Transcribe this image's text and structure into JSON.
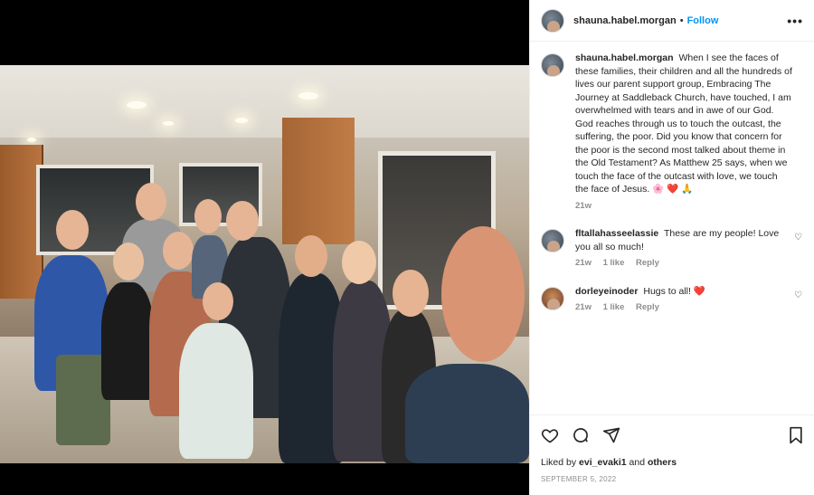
{
  "header": {
    "username": "shauna.habel.morgan",
    "separator": "•",
    "follow_label": "Follow",
    "more_label": "•••"
  },
  "caption": {
    "username": "shauna.habel.morgan",
    "text": "When I see the faces of these families, their children and all the hundreds of lives our parent support group, Embracing The Journey at Saddleback Church, have touched, I am overwhelmed with tears and in awe of our God. God reaches through us to touch the outcast, the suffering, the poor. Did you know that concern for the poor is the second most talked about theme in the Old Testament? As Matthew 25 says, when we touch the face of the outcast with love, we touch the face of Jesus.",
    "emoji": "🌸 ❤️ 🙏",
    "time": "21w"
  },
  "comments": [
    {
      "username": "fltallahasseelassie",
      "text": "These are my people! Love you all so much!",
      "time": "21w",
      "likes": "1 like",
      "reply": "Reply"
    },
    {
      "username": "dorleyeinoder",
      "text": "Hugs to all!",
      "emoji": "❤️",
      "time": "21w",
      "likes": "1 like",
      "reply": "Reply"
    }
  ],
  "footer": {
    "liked_prefix": "Liked by",
    "liked_user": "evi_evaki1",
    "liked_and": "and",
    "liked_others": "others",
    "date": "SEPTEMBER 5, 2022"
  },
  "icons": {
    "like": "heart-icon",
    "comment": "comment-icon",
    "share": "share-icon",
    "save": "bookmark-icon"
  }
}
